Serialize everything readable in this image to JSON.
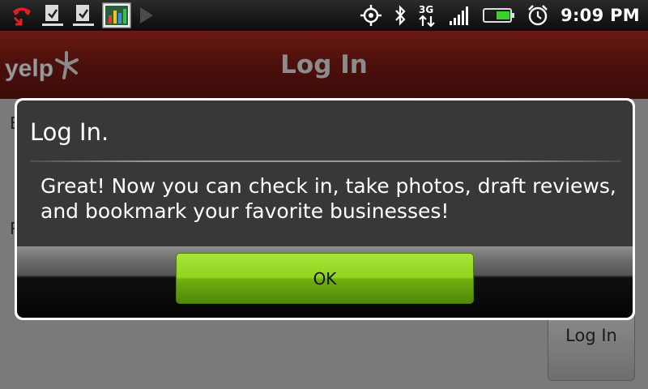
{
  "status_bar": {
    "time": "9:09 PM",
    "network_label": "3G",
    "left_icons": [
      "missed-call-icon",
      "download-complete-icon",
      "download-complete-icon",
      "chart-app-icon",
      "play-icon"
    ],
    "right_icons": [
      "gps-icon",
      "bluetooth-icon",
      "3g-data-icon",
      "signal-icon",
      "battery-icon",
      "alarm-icon"
    ]
  },
  "app_bar": {
    "logo": "yelp",
    "title": "Log In"
  },
  "background": {
    "login_button_label": "Log In"
  },
  "dialog": {
    "title": "Log In.",
    "message": "Great! Now you can check in, take photos, draft reviews, and bookmark your favorite businesses!",
    "ok_label": "OK"
  },
  "colors": {
    "app_bar": "#4e100c",
    "dialog_bg": "#383838",
    "ok_button": "#8fd41d"
  }
}
